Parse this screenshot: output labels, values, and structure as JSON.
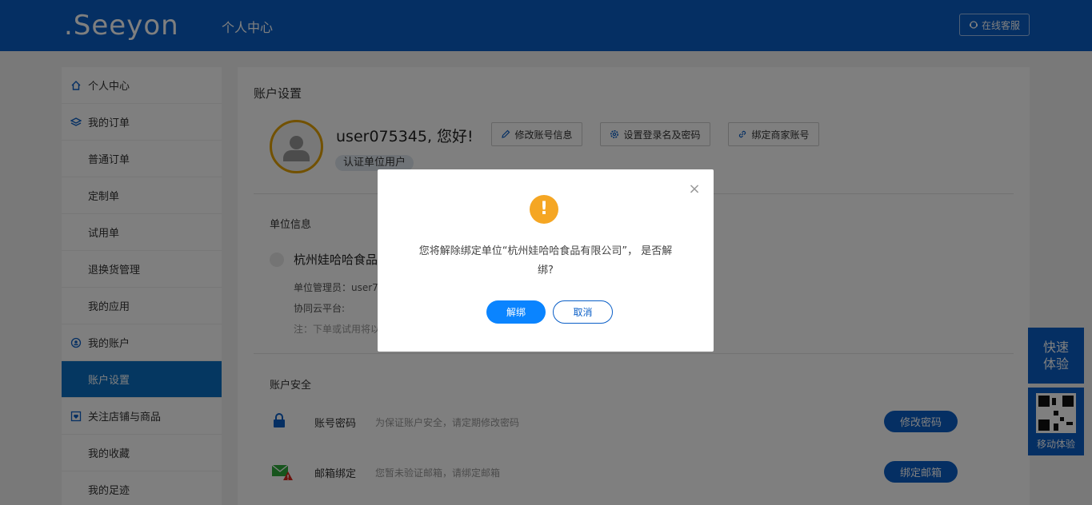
{
  "header": {
    "logo": ".Seeyon",
    "title": "个人中心",
    "service_label": "在线客服"
  },
  "sidebar": {
    "items": [
      {
        "label": "个人中心",
        "icon": "home-icon"
      },
      {
        "label": "我的订单",
        "icon": "layers-icon"
      },
      {
        "label": "普通订单"
      },
      {
        "label": "定制单"
      },
      {
        "label": "试用单"
      },
      {
        "label": "退换货管理"
      },
      {
        "label": "我的应用"
      },
      {
        "label": "我的账户",
        "icon": "account-icon"
      },
      {
        "label": "账户设置",
        "active": true
      },
      {
        "label": "关注店铺与商品",
        "icon": "heart-box-icon"
      },
      {
        "label": "我的收藏"
      },
      {
        "label": "我的足迹"
      }
    ]
  },
  "main": {
    "title": "账户设置",
    "greeting": "user075345, 您好!",
    "role": "认证单位用户",
    "buttons": {
      "edit_account": "修改账号信息",
      "set_login": "设置登录名及密码",
      "bind_merchant": "绑定商家账号"
    },
    "org_section_title": "单位信息",
    "org_name": "杭州娃哈哈食品",
    "org_admin": "单位管理员：user7",
    "org_platform": "协同云平台:",
    "org_note": "注：下单或试用将以",
    "security_title": "账户安全",
    "security": {
      "password_label": "账号密码",
      "password_desc": "为保证账户安全，请定期修改密码",
      "password_btn": "修改密码",
      "email_label": "邮箱绑定",
      "email_desc": "您暂未验证邮箱，请绑定邮箱",
      "email_btn": "绑定邮箱"
    }
  },
  "float": {
    "quick_line1": "快速",
    "quick_line2": "体验",
    "mobile": "移动体验"
  },
  "dialog": {
    "message_line1": "您将解除绑定单位“杭州娃哈哈食品有限公司”， 是否解",
    "message_line2": "绑?",
    "confirm_label": "解绑",
    "cancel_label": "取消",
    "close_symbol": "×",
    "warn_symbol": "!"
  },
  "colors": {
    "brand": "#0b5fc7",
    "active_sidebar": "#0b6fc2",
    "warning": "#f5a623",
    "confirm": "#0a84ff"
  }
}
